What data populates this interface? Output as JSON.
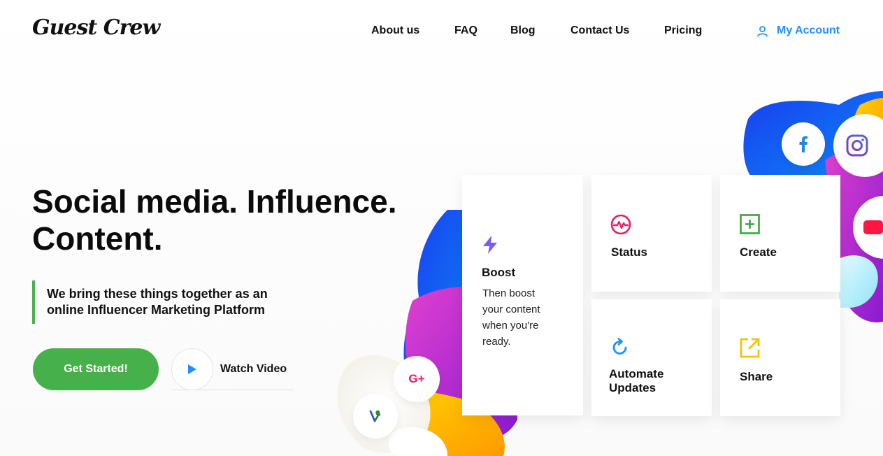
{
  "header": {
    "logo": "Guest Crew",
    "nav": [
      "About us",
      "FAQ",
      "Blog",
      "Contact Us",
      "Pricing"
    ],
    "account_label": "My Account"
  },
  "hero": {
    "title_line1": "Social media. Influence.",
    "title_line2": "Content.",
    "quote_line1": "We bring these things together as an",
    "quote_line2": "online Influencer Marketing Platform",
    "cta_label": "Get Started!",
    "watch_label": "Watch Video"
  },
  "features": {
    "boost": {
      "title": "Boost",
      "desc_lines": [
        "Then boost",
        "your content",
        "when you're",
        "ready."
      ]
    },
    "status": {
      "title": "Status"
    },
    "create": {
      "title": "Create"
    },
    "automate": {
      "title_line1": "Automate",
      "title_line2": "Updates"
    },
    "share": {
      "title": "Share"
    }
  },
  "social_icons": [
    "facebook-icon",
    "instagram-icon",
    "youtube-icon",
    "google-plus-icon",
    "vine-icon"
  ],
  "social_labels": {
    "google_plus": "G+"
  },
  "colors": {
    "accent_green": "#46b04a",
    "link_blue": "#1e90ff",
    "boost_purple": "#7b5cf0",
    "status_pink": "#e91e63",
    "create_green": "#3aa53e",
    "automate_blue": "#1e90ff",
    "share_yellow": "#f4c20d"
  }
}
